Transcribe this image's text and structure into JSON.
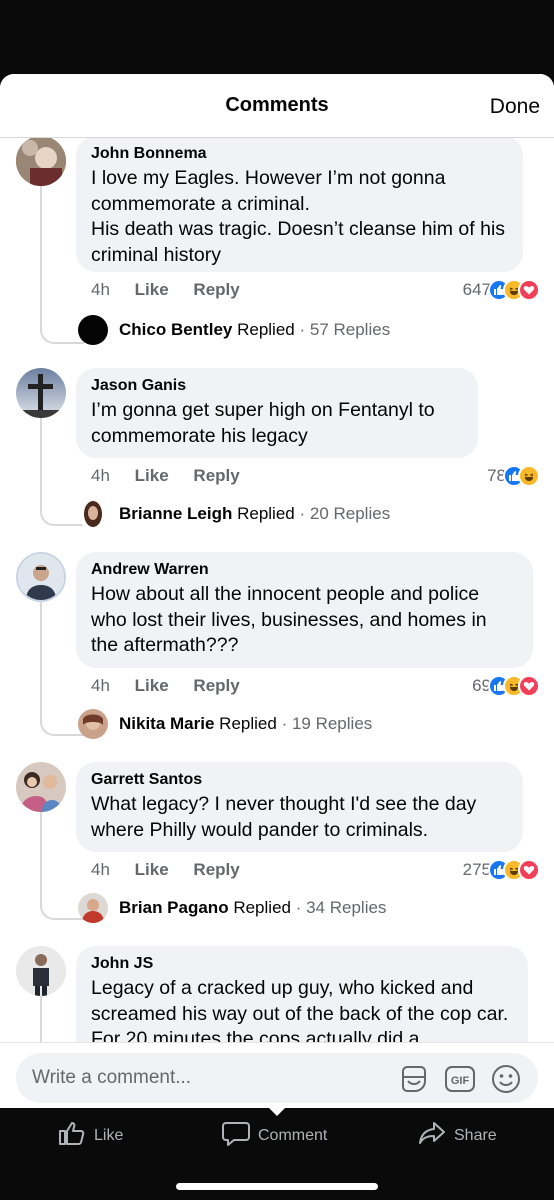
{
  "header": {
    "title": "Comments",
    "done_label": "Done"
  },
  "comments": [
    {
      "name": "John Bonnema",
      "text": "I love my Eagles. However I’m not gonna commemorate a criminal.\nHis death was tragic. Doesn’t cleanse him of his criminal history",
      "time": "4h",
      "like_label": "Like",
      "reply_label": "Reply",
      "reaction_count": "647",
      "reactions": [
        "like-reaction-icon",
        "haha-reaction-icon",
        "love-reaction-icon"
      ],
      "reply": {
        "name": "Chico Bentley",
        "replied": "Replied",
        "count": "· 57 Replies"
      }
    },
    {
      "name": "Jason Ganis",
      "text": "I’m gonna get super high on Fentanyl to commemorate his legacy",
      "time": "4h",
      "like_label": "Like",
      "reply_label": "Reply",
      "reaction_count": "78",
      "reactions": [
        "like-reaction-icon",
        "haha-reaction-icon"
      ],
      "reply": {
        "name": "Brianne Leigh",
        "replied": "Replied",
        "count": "· 20 Replies"
      }
    },
    {
      "name": "Andrew Warren",
      "text": "How about all the innocent people and police who lost their lives, businesses, and homes in the aftermath???",
      "time": "4h",
      "like_label": "Like",
      "reply_label": "Reply",
      "reaction_count": "69",
      "reactions": [
        "like-reaction-icon",
        "haha-reaction-icon",
        "love-reaction-icon"
      ],
      "reply": {
        "name": "Nikita Marie",
        "replied": "Replied",
        "count": "· 19 Replies"
      }
    },
    {
      "name": "Garrett Santos",
      "text": "What legacy? I never thought I'd see the day where Philly would pander to criminals.",
      "time": "4h",
      "like_label": "Like",
      "reply_label": "Reply",
      "reaction_count": "275",
      "reactions": [
        "like-reaction-icon",
        "haha-reaction-icon",
        "love-reaction-icon"
      ],
      "reply": {
        "name": "Brian Pagano",
        "replied": "Replied",
        "count": "· 34 Replies"
      }
    },
    {
      "name": "John JS",
      "text": "Legacy of a cracked up guy, who kicked and screamed his way out of the back of the cop car. For 20 minutes the cops actually did a"
    }
  ],
  "composer": {
    "placeholder": "Write a comment..."
  },
  "bottom_tabs": {
    "like": "Like",
    "comment": "Comment",
    "share": "Share"
  },
  "colors": {
    "accent": "#1877f2",
    "haha": "#f7b928",
    "love": "#f33e58",
    "bubble": "#f0f2f5",
    "muted": "#65676b"
  }
}
